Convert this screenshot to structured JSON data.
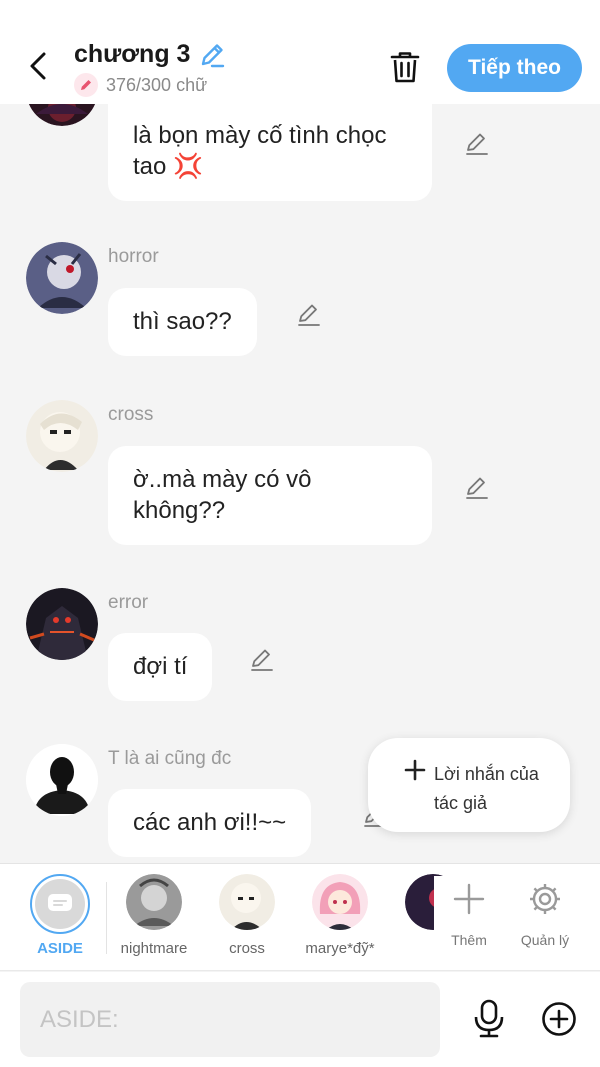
{
  "header": {
    "title": "chương 3",
    "count": "376/300 chữ",
    "next_label": "Tiếp theo"
  },
  "messages": [
    {
      "sender": "",
      "text": "là bọn mày cố tình chọc tao 💢"
    },
    {
      "sender": "horror",
      "text": "thì sao??"
    },
    {
      "sender": "cross",
      "text": "ờ..mà mày có vô không??"
    },
    {
      "sender": "error",
      "text": "đợi tí"
    },
    {
      "sender": "T là ai cũng đc",
      "text": "các anh ơi!!~~"
    }
  ],
  "author_note": {
    "label": "Lời nhắn của tác giả",
    "icon": "plus-icon"
  },
  "characters": [
    {
      "label": "ASIDE",
      "selected": true
    },
    {
      "label": "nightmare"
    },
    {
      "label": "cross"
    },
    {
      "label": "marye*đỹ*"
    }
  ],
  "tools": {
    "add_label": "Thêm",
    "manage_label": "Quản lý"
  },
  "input": {
    "placeholder": "ASIDE:"
  },
  "colors": {
    "accent": "#52a8f2",
    "background": "#f4f4f4",
    "bubble": "#ffffff"
  }
}
